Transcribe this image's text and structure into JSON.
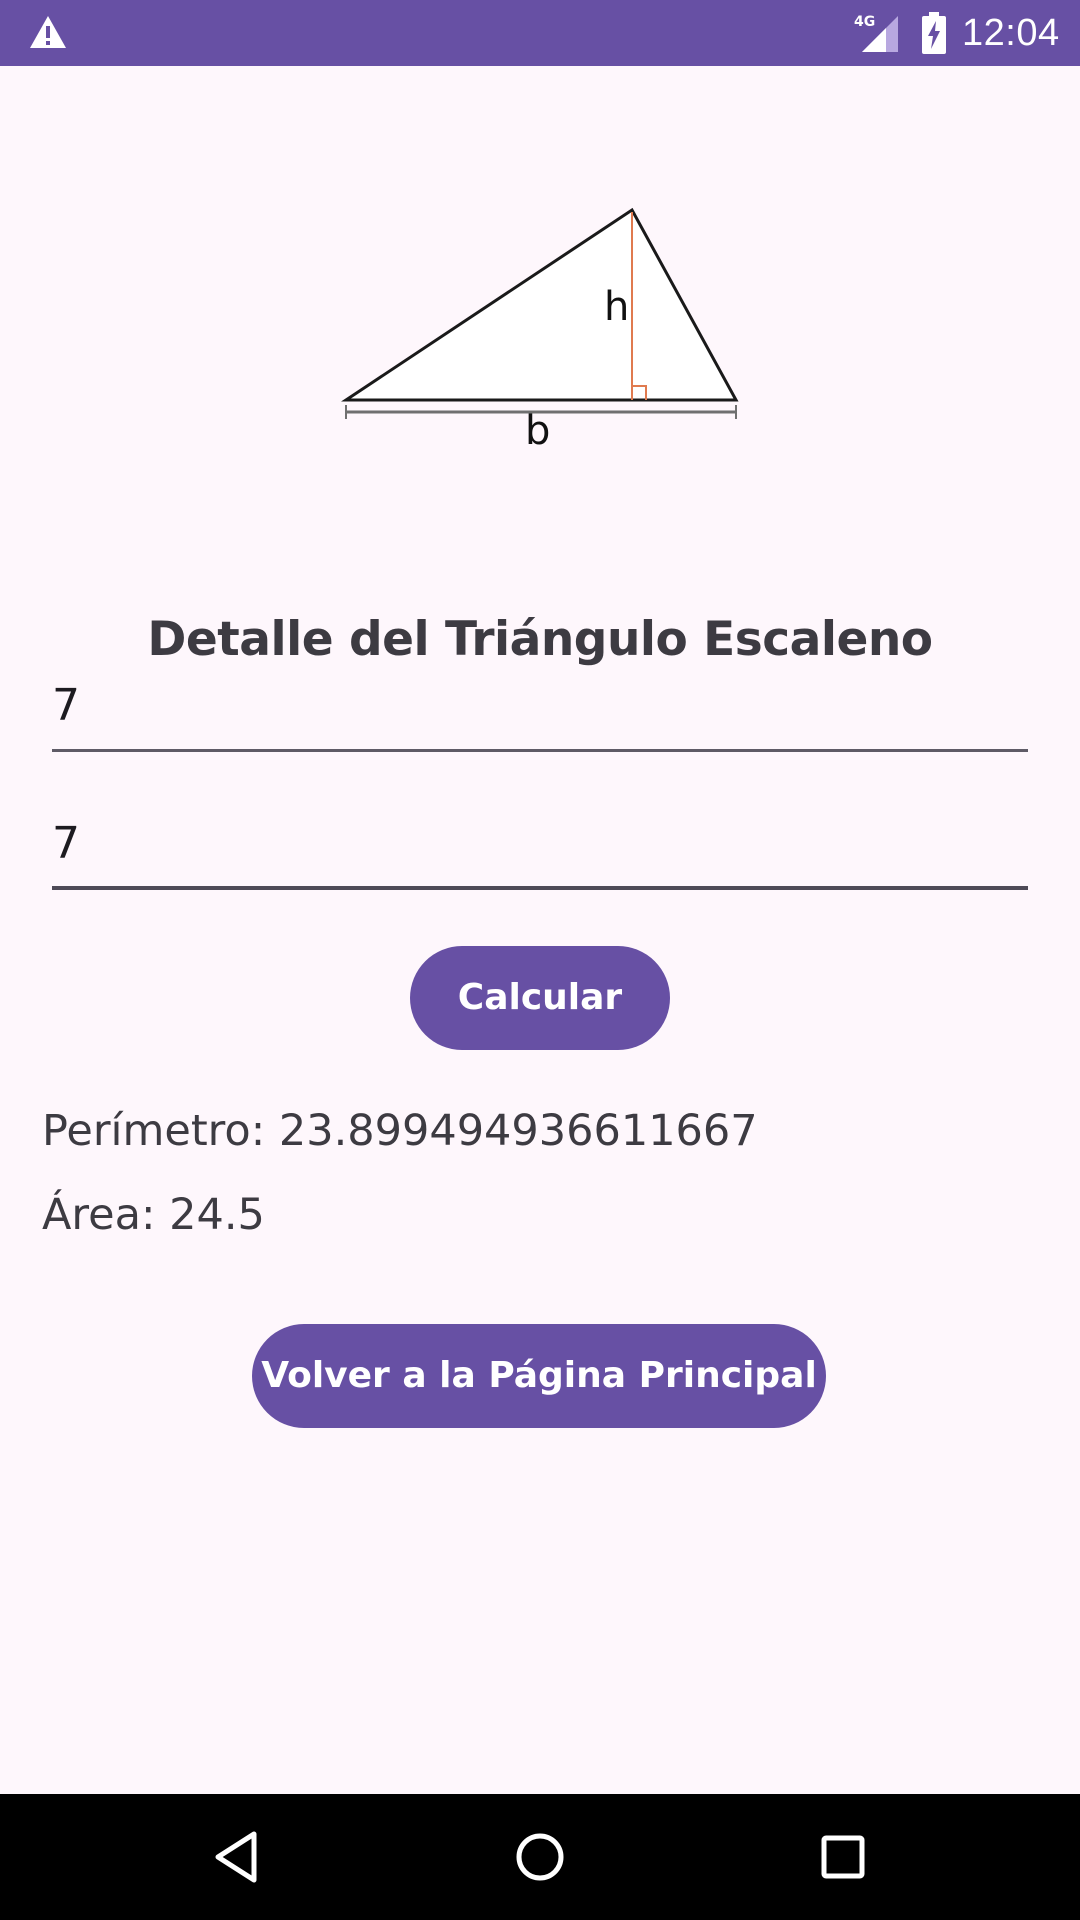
{
  "status_bar": {
    "time": "12:04",
    "network_label": "4G",
    "icons": [
      "warning-icon",
      "signal-4g-icon",
      "battery-charging-icon"
    ],
    "background_color": "#6750a4"
  },
  "illustration": {
    "height_label": "h",
    "base_label": "b"
  },
  "page": {
    "title": "Detalle del Triángulo Escaleno"
  },
  "form": {
    "base_value": "7",
    "height_value": "7"
  },
  "buttons": {
    "calculate_label": "Calcular",
    "back_label": "Volver a la Página Principal"
  },
  "results": {
    "perimeter": "Perímetro: 23.899494936611667",
    "area": "Área: 24.5"
  },
  "nav_bar": {
    "icons": [
      "back-icon",
      "home-icon",
      "recents-icon"
    ]
  },
  "colors": {
    "accent": "#6750a4",
    "background": "#fef7fc",
    "text": "#3d3b42",
    "height_line": "#e07a4f"
  }
}
